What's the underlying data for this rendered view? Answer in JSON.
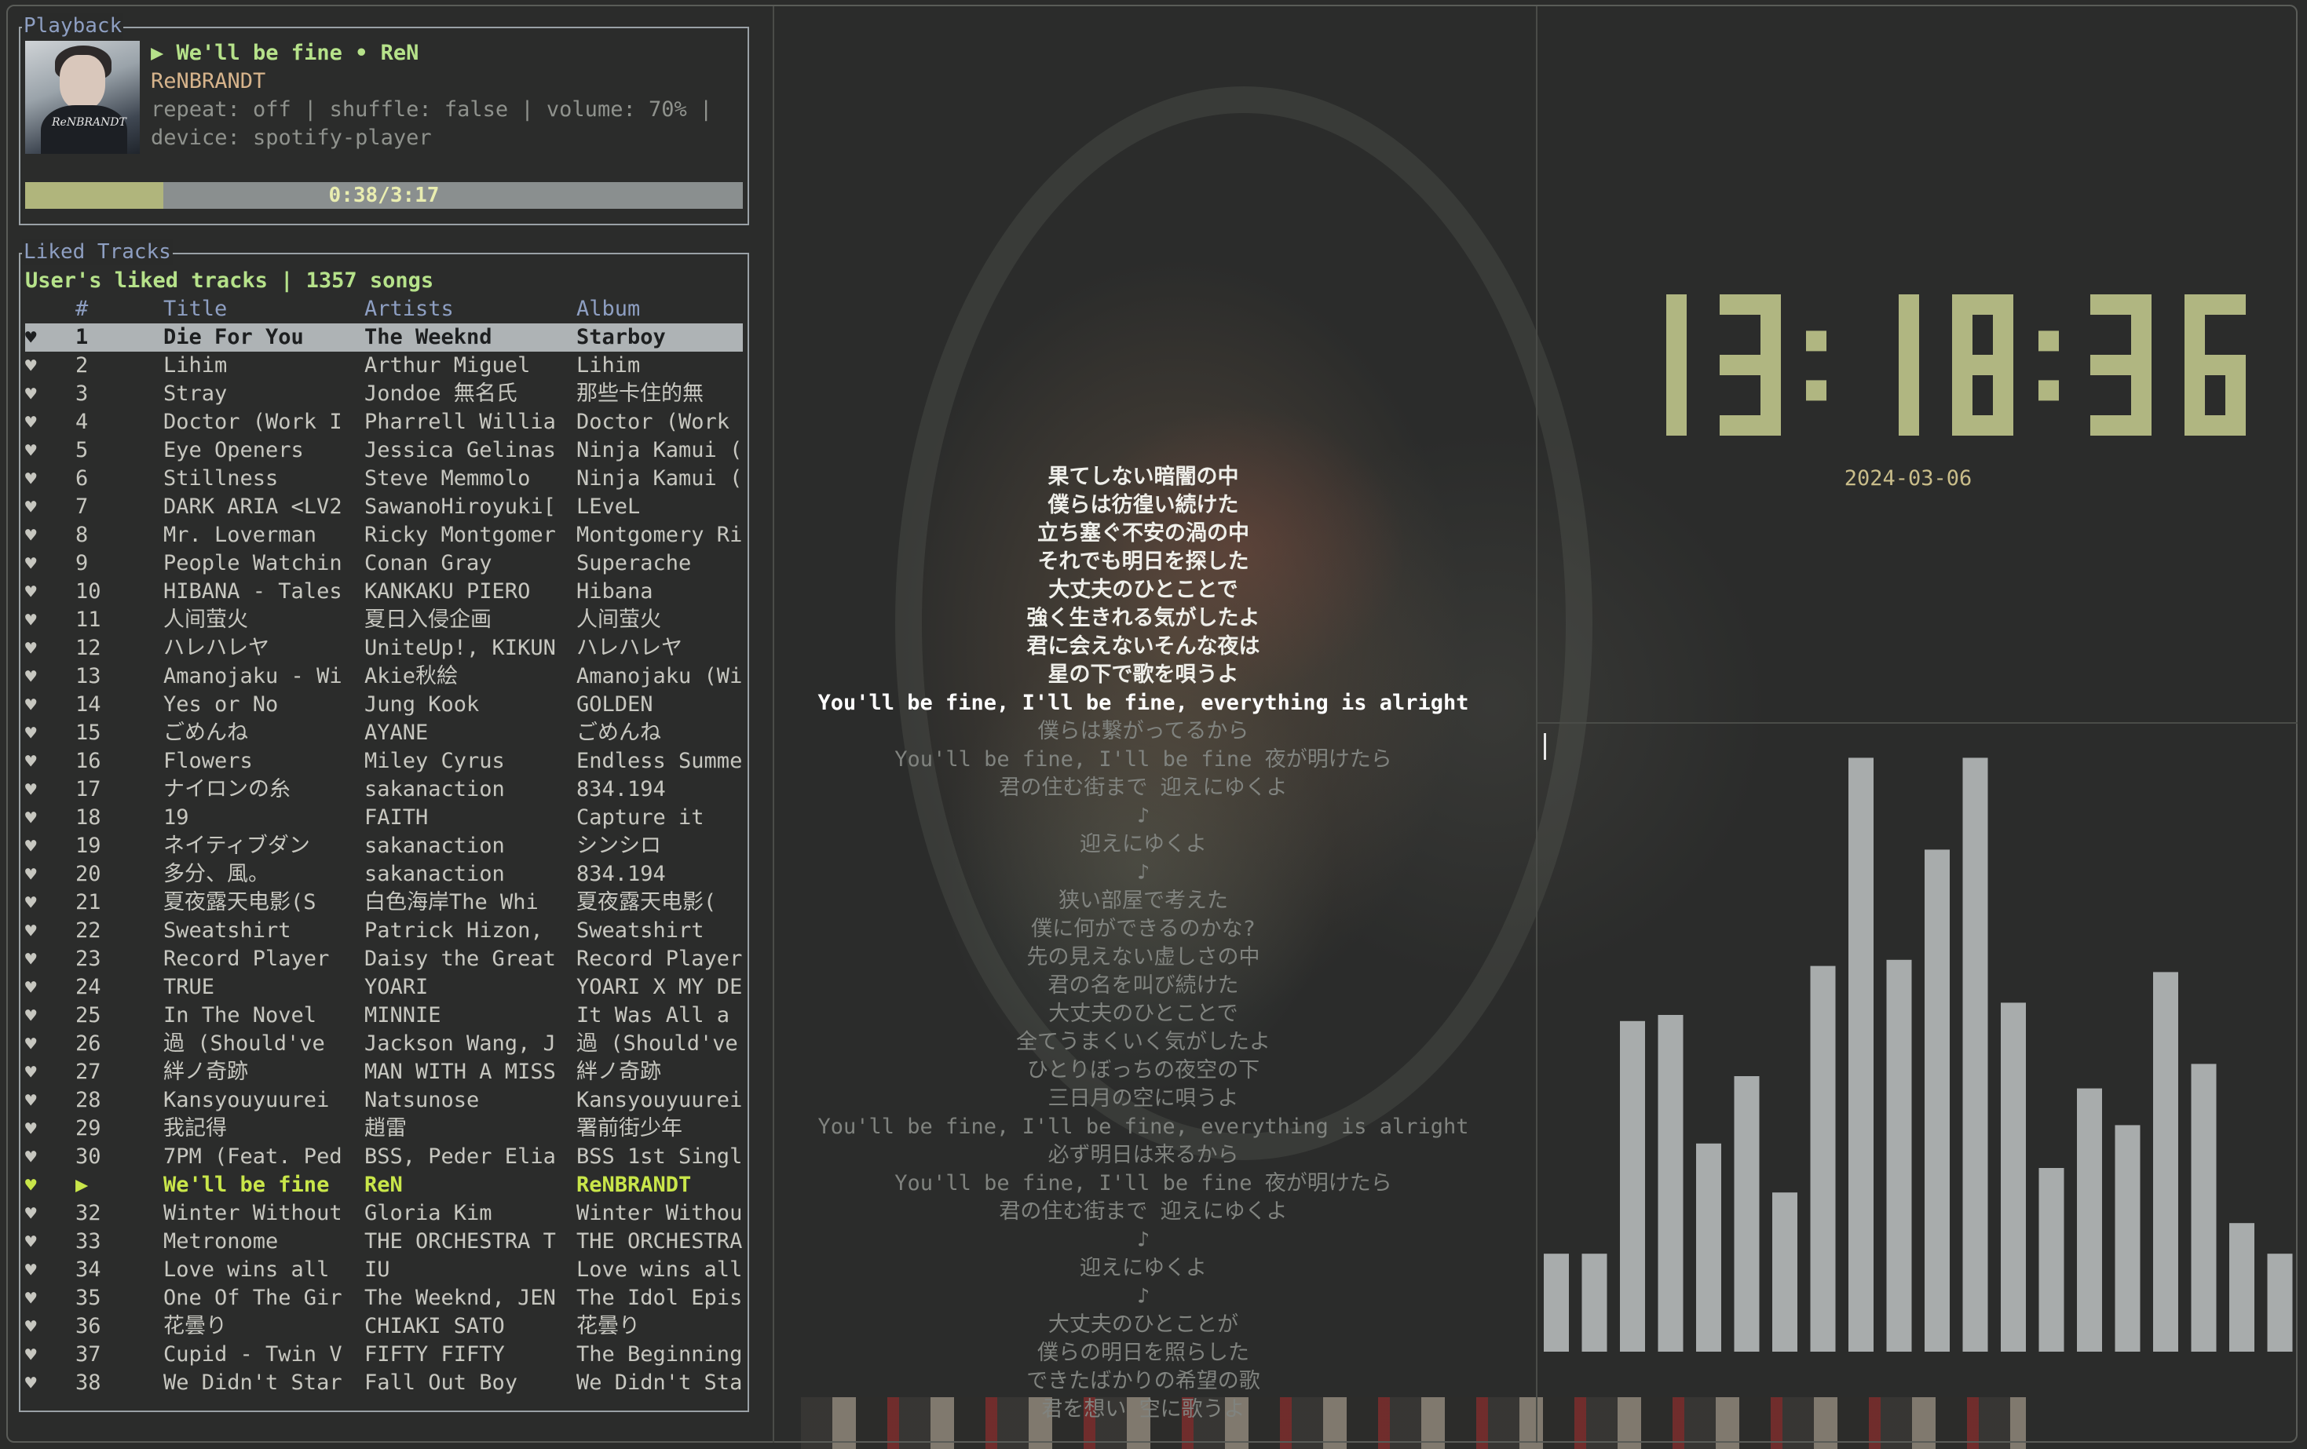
{
  "colors": {
    "accent_green": "#b6e28a",
    "playing_yellow": "#c9e64a",
    "panel_title": "#8e9fc2",
    "clock": "#b0b681",
    "visualizer_bar": "#a8acac"
  },
  "playback": {
    "panel_title": "Playback",
    "title_line": "▶ We'll be fine • ReN",
    "artist_line": "ReNBRANDT",
    "info_line1": "repeat: off | shuffle: false | volume: 70% |",
    "info_line2": "device: spotify-player",
    "progress_label": "0:38/3:17",
    "progress_fraction": 0.193,
    "cover_icon": "album-cover-image",
    "cover_signature": "ReNBRANDT"
  },
  "liked": {
    "panel_title": "Liked Tracks",
    "header": "User's liked tracks | 1357 songs",
    "columns": {
      "num": "#",
      "title": "Title",
      "artists": "Artists",
      "album": "Album"
    },
    "heart_icon": "heart-icon",
    "rows": [
      {
        "n": "1",
        "t": "Die For You",
        "a": "The Weeknd",
        "al": "Starboy",
        "state": "selected"
      },
      {
        "n": "2",
        "t": "Lihim",
        "a": "Arthur Miguel",
        "al": "Lihim"
      },
      {
        "n": "3",
        "t": "Stray",
        "a": "Jondoe 無名氏",
        "al": "那些卡住的無"
      },
      {
        "n": "4",
        "t": "Doctor (Work I",
        "a": "Pharrell Willia",
        "al": "Doctor (Work"
      },
      {
        "n": "5",
        "t": "Eye Openers",
        "a": "Jessica Gelinas",
        "al": "Ninja Kamui ("
      },
      {
        "n": "6",
        "t": "Stillness",
        "a": "Steve Memmolo",
        "al": "Ninja Kamui ("
      },
      {
        "n": "7",
        "t": "DARK ARIA <LV2",
        "a": "SawanoHiroyuki[",
        "al": "LEveL"
      },
      {
        "n": "8",
        "t": "Mr. Loverman",
        "a": "Ricky Montgomer",
        "al": "Montgomery Ri"
      },
      {
        "n": "9",
        "t": "People Watchin",
        "a": "Conan Gray",
        "al": "Superache"
      },
      {
        "n": "10",
        "t": "HIBANA - Tales",
        "a": "KANKAKU PIERO",
        "al": "Hibana"
      },
      {
        "n": "11",
        "t": "人间萤火",
        "a": "夏日入侵企画",
        "al": "人间萤火"
      },
      {
        "n": "12",
        "t": "ハレハレヤ",
        "a": "UniteUp!, KIKUN",
        "al": "ハレハレヤ"
      },
      {
        "n": "13",
        "t": "Amanojaku - Wi",
        "a": "Akie秋絵",
        "al": "Amanojaku (Wi"
      },
      {
        "n": "14",
        "t": "Yes or No",
        "a": "Jung Kook",
        "al": "GOLDEN"
      },
      {
        "n": "15",
        "t": "ごめんね",
        "a": "AYANE",
        "al": "ごめんね"
      },
      {
        "n": "16",
        "t": "Flowers",
        "a": "Miley Cyrus",
        "al": "Endless Summe"
      },
      {
        "n": "17",
        "t": "ナイロンの糸",
        "a": "sakanaction",
        "al": "834.194"
      },
      {
        "n": "18",
        "t": "19",
        "a": "FAITH",
        "al": "Capture it"
      },
      {
        "n": "19",
        "t": "ネイティブダン",
        "a": "sakanaction",
        "al": "シンシロ"
      },
      {
        "n": "20",
        "t": "多分、風。",
        "a": "sakanaction",
        "al": "834.194"
      },
      {
        "n": "21",
        "t": "夏夜露天电影(S",
        "a": "白色海岸The Whi",
        "al": "夏夜露天电影("
      },
      {
        "n": "22",
        "t": "Sweatshirt",
        "a": "Patrick Hizon,",
        "al": "Sweatshirt"
      },
      {
        "n": "23",
        "t": "Record Player",
        "a": "Daisy the Great",
        "al": "Record Player"
      },
      {
        "n": "24",
        "t": "TRUE",
        "a": "YOARI",
        "al": "YOARI X MY DE"
      },
      {
        "n": "25",
        "t": "In The Novel",
        "a": "MINNIE",
        "al": "It Was All a"
      },
      {
        "n": "26",
        "t": "過 (Should've",
        "a": "Jackson Wang, J",
        "al": "過 (Should've"
      },
      {
        "n": "27",
        "t": "絆ノ奇跡",
        "a": "MAN WITH A MISS",
        "al": "絆ノ奇跡"
      },
      {
        "n": "28",
        "t": "Kansyouyuurei",
        "a": "Natsunose",
        "al": "Kansyouyuurei"
      },
      {
        "n": "29",
        "t": "我記得",
        "a": "趙雷",
        "al": "署前街少年"
      },
      {
        "n": "30",
        "t": "7PM (Feat. Ped",
        "a": "BSS, Peder Elia",
        "al": "BSS 1st Singl"
      },
      {
        "n": "▶",
        "t": "We'll be fine",
        "a": "ReN",
        "al": "ReNBRANDT",
        "state": "playing"
      },
      {
        "n": "32",
        "t": "Winter Without",
        "a": "Gloria Kim",
        "al": "Winter Withou"
      },
      {
        "n": "33",
        "t": "Metronome",
        "a": "THE ORCHESTRA T",
        "al": "THE ORCHESTRA"
      },
      {
        "n": "34",
        "t": "Love wins all",
        "a": "IU",
        "al": "Love wins all"
      },
      {
        "n": "35",
        "t": "One Of The Gir",
        "a": "The Weeknd, JEN",
        "al": "The Idol Epis"
      },
      {
        "n": "36",
        "t": "花曇り",
        "a": "CHIAKI SATO",
        "al": "花曇り"
      },
      {
        "n": "37",
        "t": "Cupid - Twin V",
        "a": "FIFTY FIFTY",
        "al": "The Beginning"
      },
      {
        "n": "38",
        "t": "We Didn't Star",
        "a": "Fall Out Boy",
        "al": "We Didn't Sta"
      }
    ]
  },
  "lyrics": [
    {
      "text": "果てしない暗闇の中",
      "state": "past"
    },
    {
      "text": "僕らは彷徨い続けた",
      "state": "past"
    },
    {
      "text": "立ち塞ぐ不安の渦の中",
      "state": "past"
    },
    {
      "text": "それでも明日を探した",
      "state": "past"
    },
    {
      "text": "大丈夫のひとことで",
      "state": "past"
    },
    {
      "text": "強く生きれる気がしたよ",
      "state": "past"
    },
    {
      "text": "君に会えないそんな夜は",
      "state": "past"
    },
    {
      "text": "星の下で歌を唄うよ",
      "state": "past"
    },
    {
      "text": "You'll be fine, I'll be fine, everything is alright",
      "state": "current"
    },
    {
      "text": "僕らは繋がってるから",
      "state": "future"
    },
    {
      "text": "You'll be fine, I'll be fine 夜が明けたら",
      "state": "future"
    },
    {
      "text": "君の住む街まで 迎えにゆくよ",
      "state": "future"
    },
    {
      "text": "♪",
      "state": "future"
    },
    {
      "text": "迎えにゆくよ",
      "state": "future"
    },
    {
      "text": "♪",
      "state": "future"
    },
    {
      "text": "狭い部屋で考えた",
      "state": "future"
    },
    {
      "text": "僕に何ができるのかな?",
      "state": "future"
    },
    {
      "text": "先の見えない虚しさの中",
      "state": "future"
    },
    {
      "text": "君の名を叫び続けた",
      "state": "future"
    },
    {
      "text": "大丈夫のひとことで",
      "state": "future"
    },
    {
      "text": "全てうまくいく気がしたよ",
      "state": "future"
    },
    {
      "text": "ひとりぼっちの夜空の下",
      "state": "future"
    },
    {
      "text": "三日月の空に唄うよ",
      "state": "future"
    },
    {
      "text": "You'll be fine, I'll be fine, everything is alright",
      "state": "future"
    },
    {
      "text": "必ず明日は来るから",
      "state": "future"
    },
    {
      "text": "You'll be fine, I'll be fine 夜が明けたら",
      "state": "future"
    },
    {
      "text": "君の住む街まで 迎えにゆくよ",
      "state": "future"
    },
    {
      "text": "♪",
      "state": "future"
    },
    {
      "text": "迎えにゆくよ",
      "state": "future"
    },
    {
      "text": "♪",
      "state": "future"
    },
    {
      "text": "大丈夫のひとことが",
      "state": "future"
    },
    {
      "text": "僕らの明日を照らした",
      "state": "future"
    },
    {
      "text": "できたばかりの希望の歌",
      "state": "future"
    },
    {
      "text": "君を想い 空に歌うよ",
      "state": "future"
    }
  ],
  "clock": {
    "time": "13:18:36",
    "digits": [
      "1",
      "3",
      ":",
      "1",
      "8",
      ":",
      "3",
      "6"
    ],
    "date": "2024-03-06"
  },
  "visualizer": {
    "levels": [
      0.16,
      0.16,
      0.54,
      0.55,
      0.34,
      0.45,
      0.26,
      0.63,
      0.97,
      0.64,
      0.82,
      0.97,
      0.57,
      0.3,
      0.43,
      0.37,
      0.62,
      0.47,
      0.21,
      0.16
    ]
  }
}
